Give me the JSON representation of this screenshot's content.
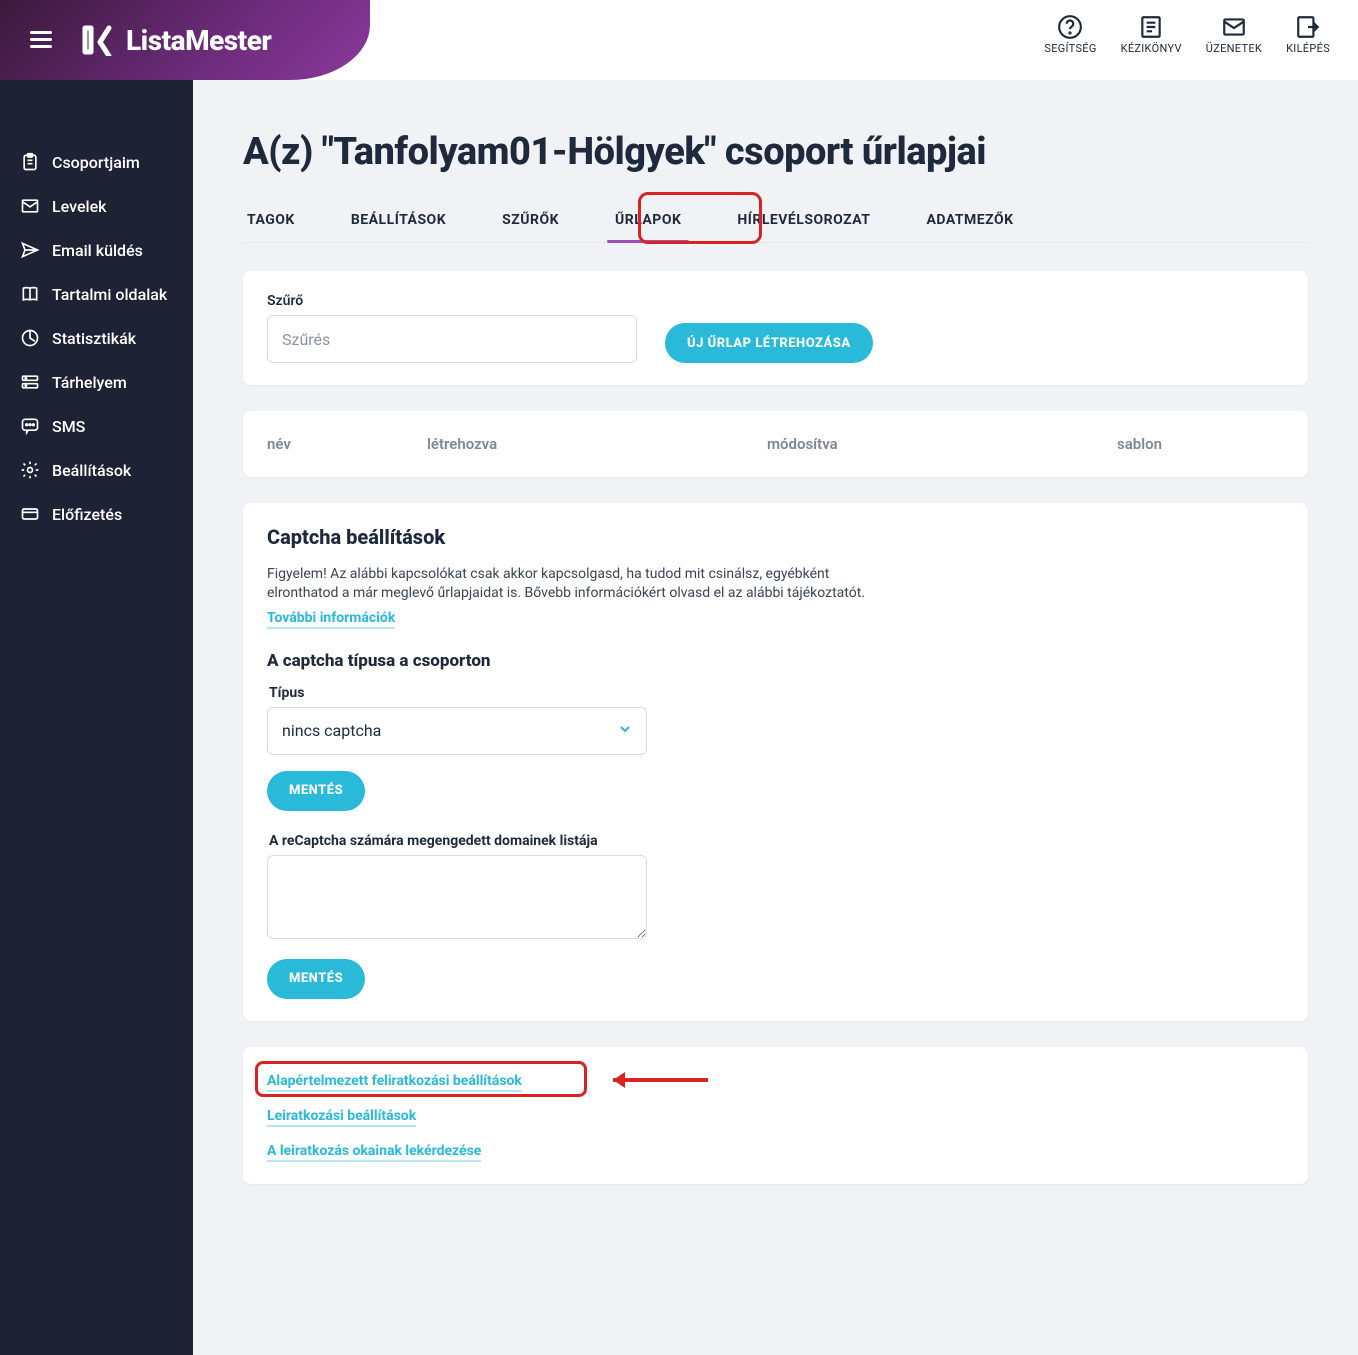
{
  "brand": {
    "name": "ListaMester"
  },
  "topbar": {
    "items": [
      {
        "label": "SEGÍTSÉG",
        "icon": "help-icon"
      },
      {
        "label": "KÉZIKÖNYV",
        "icon": "manual-icon"
      },
      {
        "label": "ÜZENETEK",
        "icon": "messages-icon"
      },
      {
        "label": "KILÉPÉS",
        "icon": "logout-icon"
      }
    ]
  },
  "sidebar": {
    "items": [
      {
        "label": "Csoportjaim",
        "icon": "clipboard-icon"
      },
      {
        "label": "Levelek",
        "icon": "envelope-icon"
      },
      {
        "label": "Email küldés",
        "icon": "send-icon"
      },
      {
        "label": "Tartalmi oldalak",
        "icon": "book-icon"
      },
      {
        "label": "Statisztikák",
        "icon": "stats-icon"
      },
      {
        "label": "Tárhelyem",
        "icon": "storage-icon"
      },
      {
        "label": "SMS",
        "icon": "sms-icon"
      },
      {
        "label": "Beállítások",
        "icon": "gear-icon"
      },
      {
        "label": "Előfizetés",
        "icon": "subscription-icon"
      }
    ]
  },
  "page": {
    "title": "A(z) \"Tanfolyam01-Hölgyek\" csoport űrlapjai"
  },
  "tabs": [
    {
      "label": "TAGOK"
    },
    {
      "label": "BEÁLLÍTÁSOK"
    },
    {
      "label": "SZŰRŐK"
    },
    {
      "label": "ŰRLAPOK",
      "active": true
    },
    {
      "label": "HÍRLEVÉLSOROZAT"
    },
    {
      "label": "ADATMEZŐK"
    }
  ],
  "filter": {
    "label": "Szűrő",
    "placeholder": "Szűrés",
    "new_button": "ÚJ ŰRLAP LÉTREHOZÁSA"
  },
  "table": {
    "headers": {
      "name": "név",
      "created": "létrehozva",
      "modified": "módosítva",
      "template": "sablon"
    }
  },
  "captcha": {
    "title": "Captcha beállítások",
    "description": "Figyelem! Az alábbi kapcsolókat csak akkor kapcsolgasd, ha tudod mit csinálsz, egyébként elronthatod a már meglevő űrlapjaidat is. Bővebb információkért olvasd el az alábbi tájékoztatót.",
    "more_info_link": "További információk",
    "subtype_title": "A captcha típusa a csoporton",
    "type_label": "Típus",
    "type_value": "nincs captcha",
    "save_label": "MENTÉS",
    "domains_label": "A reCaptcha számára megengedett domainek listája",
    "domains_value": ""
  },
  "settings_links": {
    "default_subscribe": "Alapértelmezett feliratkozási beállítások",
    "unsubscribe": "Leiratkozási beállítások",
    "unsubscribe_reasons": "A leiratkozás okainak lekérdezése"
  }
}
